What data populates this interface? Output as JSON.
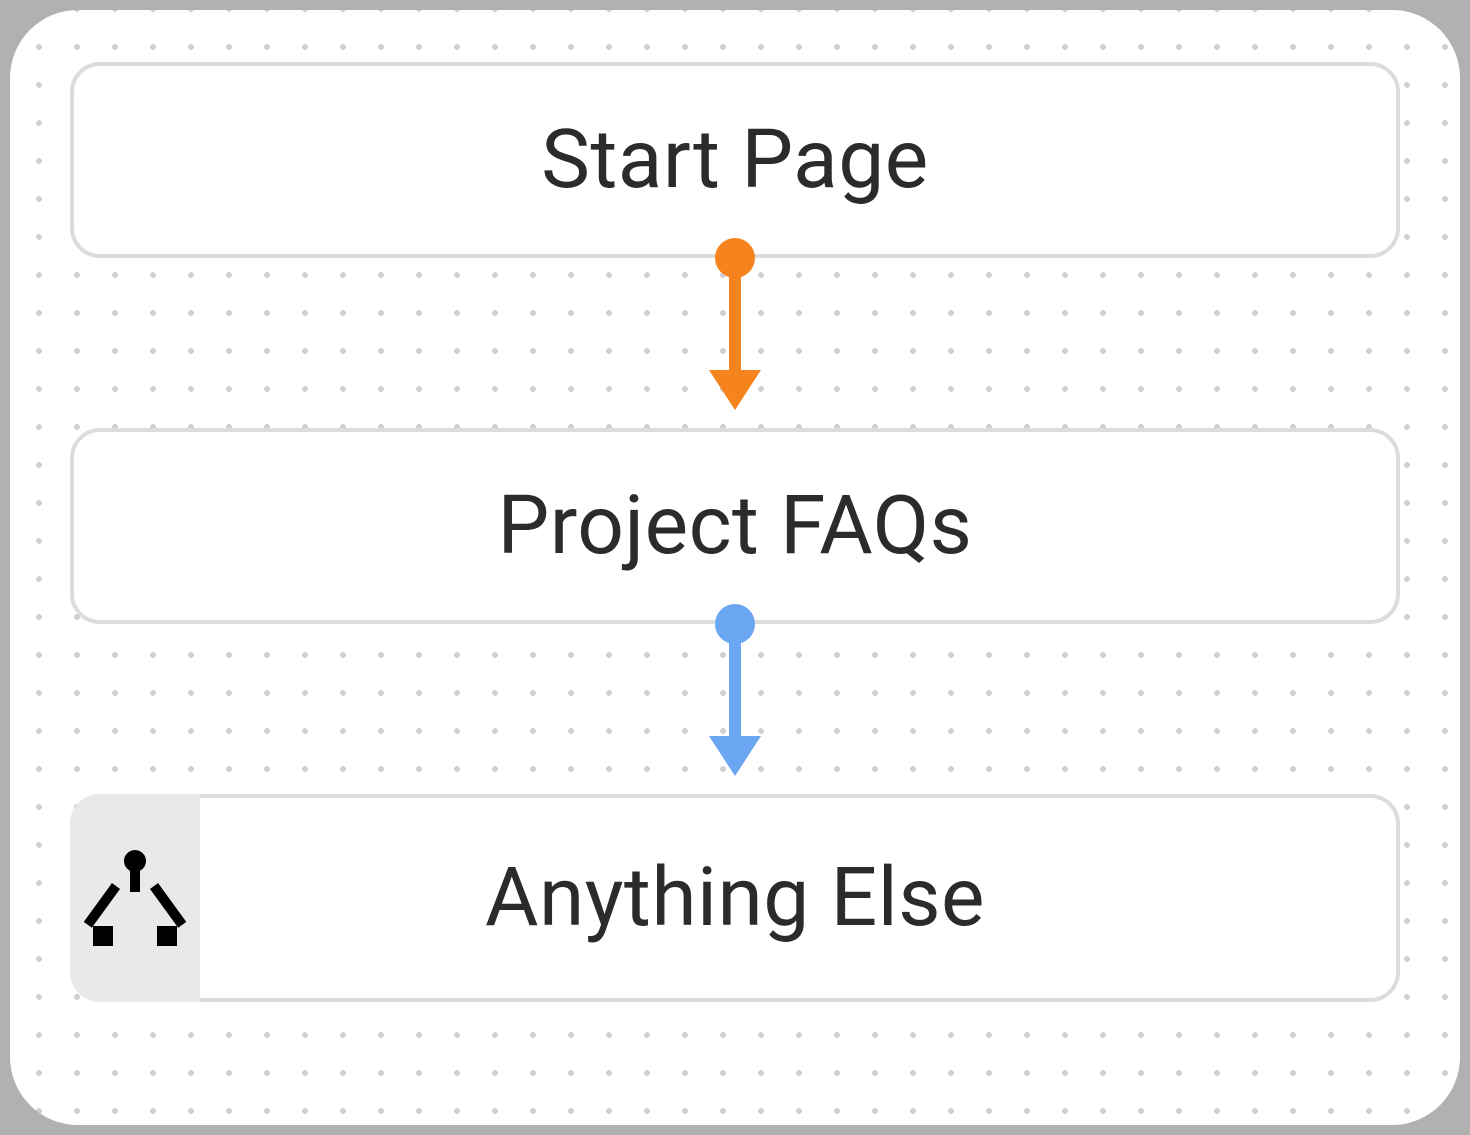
{
  "flow": {
    "nodes": {
      "start": {
        "label": "Start Page"
      },
      "middle": {
        "label": "Project FAQs"
      },
      "last": {
        "label": "Anything Else",
        "icon": "hub-icon"
      }
    },
    "connectors": {
      "start_to_middle": {
        "color": "#f5841f"
      },
      "middle_to_last": {
        "color": "#6aa6f2"
      }
    }
  }
}
